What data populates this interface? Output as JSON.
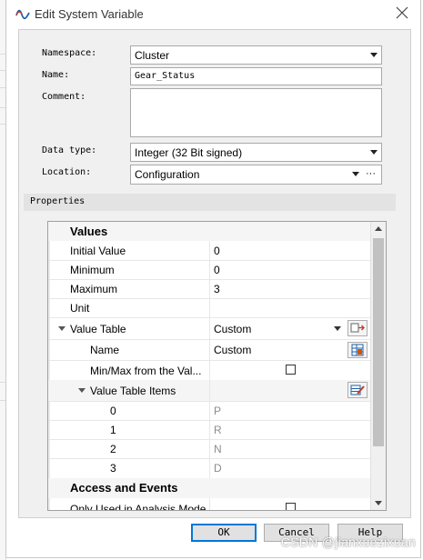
{
  "window": {
    "title": "Edit System Variable",
    "icon": "wave-icon"
  },
  "form": {
    "namespace_label": "Namespace:",
    "namespace_value": "Cluster",
    "name_label": "Name:",
    "name_value": "Gear_Status",
    "comment_label": "Comment:",
    "comment_value": "",
    "datatype_label": "Data type:",
    "datatype_value": "Integer (32 Bit signed)",
    "location_label": "Location:",
    "location_value": "Configuration",
    "location_more": "···"
  },
  "properties": {
    "header": "Properties",
    "values_category": "Values",
    "initial_label": "Initial Value",
    "initial_value": "0",
    "minimum_label": "Minimum",
    "minimum_value": "0",
    "maximum_label": "Maximum",
    "maximum_value": "3",
    "unit_label": "Unit",
    "unit_value": "",
    "value_table_label": "Value Table",
    "value_table_value": "Custom",
    "vt_name_label": "Name",
    "vt_name_value": "Custom",
    "minmax_label": "Min/Max from the Val...",
    "minmax_checked": false,
    "items_label": "Value Table Items",
    "items": [
      {
        "key": "0",
        "value": "P"
      },
      {
        "key": "1",
        "value": "R"
      },
      {
        "key": "2",
        "value": "N"
      },
      {
        "key": "3",
        "value": "D"
      }
    ],
    "access_category": "Access and Events",
    "analysis_label": "Only Used in Analysis Mode",
    "analysis_checked": false
  },
  "buttons": {
    "ok": "OK",
    "cancel": "Cancel",
    "help": "Help"
  },
  "watermark": "CSDN @jianxuezixuan"
}
